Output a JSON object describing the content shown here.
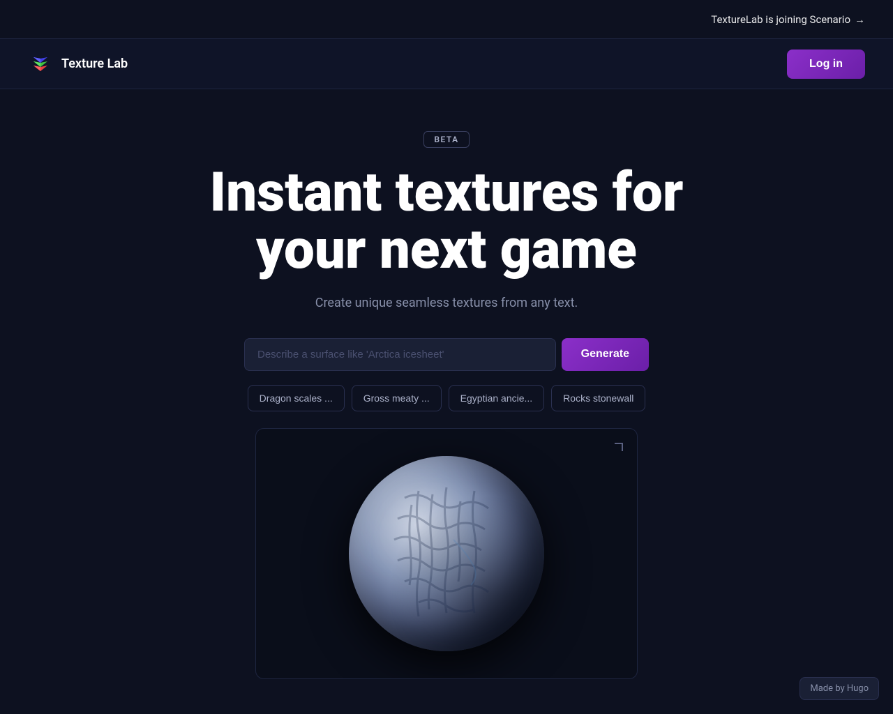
{
  "announcement": {
    "text": "TextureLab is joining Scenario",
    "arrow": "→"
  },
  "navbar": {
    "logo_text": "Texture Lab",
    "login_label": "Log in"
  },
  "hero": {
    "beta_label": "BETA",
    "title_line1": "Instant textures for",
    "title_line2": "your next game",
    "subtitle": "Create unique seamless textures from any text."
  },
  "search": {
    "placeholder": "Describe a surface like 'Arctica icesheet'",
    "generate_label": "Generate"
  },
  "chips": [
    {
      "label": "Dragon scales ..."
    },
    {
      "label": "Gross meaty ..."
    },
    {
      "label": "Egyptian ancie..."
    },
    {
      "label": "Rocks stonewall"
    }
  ],
  "footer": {
    "made_by": "Made by Hugo"
  }
}
